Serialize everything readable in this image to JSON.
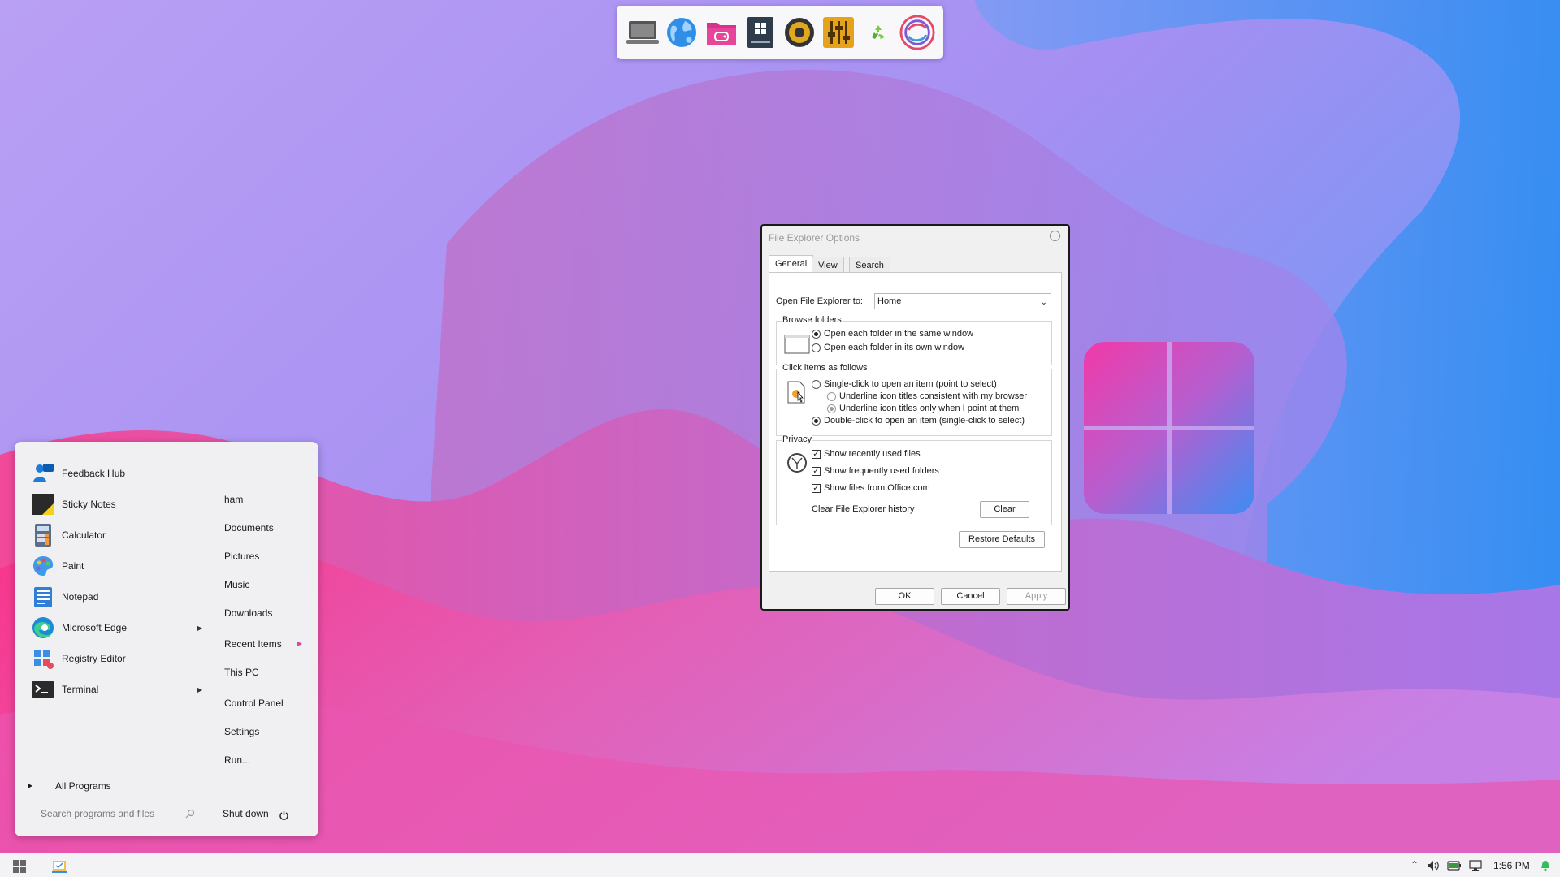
{
  "dock": {
    "items": [
      {
        "name": "laptop-icon"
      },
      {
        "name": "globe-icon"
      },
      {
        "name": "games-folder-icon"
      },
      {
        "name": "windows-box-icon"
      },
      {
        "name": "speaker-icon"
      },
      {
        "name": "equalizer-icon"
      },
      {
        "name": "recycle-icon"
      },
      {
        "name": "sync-icon"
      }
    ]
  },
  "dialog": {
    "title": "File Explorer Options",
    "tabs": [
      "General",
      "View",
      "Search"
    ],
    "open_to_label": "Open File Explorer to:",
    "open_to_value": "Home",
    "browse": {
      "title": "Browse folders",
      "same_window": "Open each folder in the same window",
      "own_window": "Open each folder in its own window"
    },
    "click": {
      "title": "Click items as follows",
      "single": "Single-click to open an item (point to select)",
      "underline_browser": "Underline icon titles consistent with my browser",
      "underline_point": "Underline icon titles only when I point at them",
      "double": "Double-click to open an item (single-click to select)"
    },
    "privacy": {
      "title": "Privacy",
      "recent_files": "Show recently used files",
      "frequent_folders": "Show frequently used folders",
      "office_files": "Show files from Office.com",
      "clear_label": "Clear File Explorer history",
      "clear_button": "Clear"
    },
    "restore_defaults": "Restore Defaults",
    "ok": "OK",
    "cancel": "Cancel",
    "apply": "Apply"
  },
  "start_menu": {
    "programs": [
      {
        "label": "Feedback Hub",
        "icon": "feedback-hub-icon"
      },
      {
        "label": "Sticky Notes",
        "icon": "sticky-notes-icon"
      },
      {
        "label": "Calculator",
        "icon": "calculator-icon"
      },
      {
        "label": "Paint",
        "icon": "paint-icon"
      },
      {
        "label": "Notepad",
        "icon": "notepad-icon"
      },
      {
        "label": "Microsoft Edge",
        "icon": "edge-icon"
      },
      {
        "label": "Registry Editor",
        "icon": "registry-editor-icon"
      },
      {
        "label": "Terminal",
        "icon": "terminal-icon"
      }
    ],
    "places": [
      "ham",
      "Documents",
      "Pictures",
      "Music",
      "Downloads",
      "Recent Items",
      "This PC",
      "Control Panel",
      "Settings",
      "Run..."
    ],
    "all_programs": "All Programs",
    "search_placeholder": "Search programs and files",
    "shutdown": "Shut down"
  },
  "taskbar": {
    "time": "1:56 PM"
  },
  "colors": {
    "accent_pink": "#e8449a",
    "accent_blue": "#3b8cf0",
    "dialog_bg": "#f0f0f0"
  }
}
